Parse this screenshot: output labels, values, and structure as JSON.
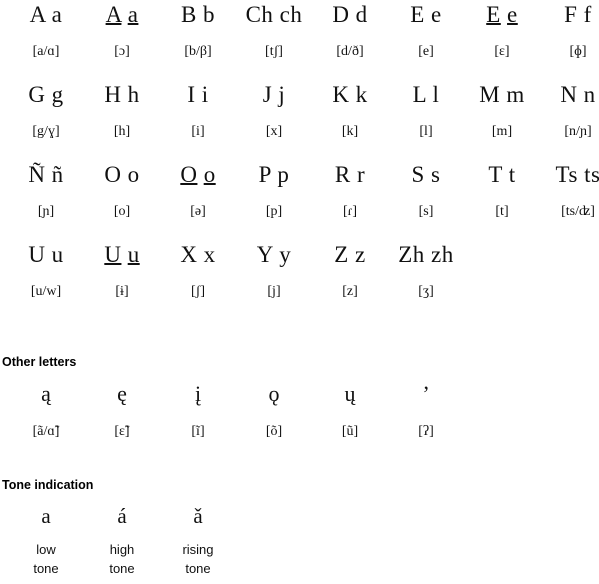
{
  "page": {
    "title": "Alphabet chart",
    "background": "#ffffff",
    "text_color": "#111111"
  },
  "alphabet": {
    "columns": 8,
    "rows": [
      [
        {
          "letter_upper": "A",
          "letter_lower": "a",
          "display": "A a",
          "underlined": false,
          "ipa": "[a/ɑ]"
        },
        {
          "letter_upper": "A̱",
          "letter_lower": "a̱",
          "display": "A a",
          "underlined": true,
          "ipa": "[ɔ]"
        },
        {
          "letter_upper": "B",
          "letter_lower": "b",
          "display": "B b",
          "underlined": false,
          "ipa": "[b/β]"
        },
        {
          "letter_upper": "Ch",
          "letter_lower": "ch",
          "display": "Ch ch",
          "underlined": false,
          "ipa": "[tʃ]"
        },
        {
          "letter_upper": "D",
          "letter_lower": "d",
          "display": "D d",
          "underlined": false,
          "ipa": "[d/ð]"
        },
        {
          "letter_upper": "E",
          "letter_lower": "e",
          "display": "E e",
          "underlined": false,
          "ipa": "[e]"
        },
        {
          "letter_upper": "E̱",
          "letter_lower": "e̱",
          "display": "E e",
          "underlined": true,
          "ipa": "[ɛ]"
        },
        {
          "letter_upper": "F",
          "letter_lower": "f",
          "display": "F f",
          "underlined": false,
          "ipa": "[ɸ]"
        }
      ],
      [
        {
          "letter_upper": "G",
          "letter_lower": "g",
          "display": "G g",
          "underlined": false,
          "ipa": "[g/ɣ]"
        },
        {
          "letter_upper": "H",
          "letter_lower": "h",
          "display": "H h",
          "underlined": false,
          "ipa": "[h]"
        },
        {
          "letter_upper": "I",
          "letter_lower": "i",
          "display": "I i",
          "underlined": false,
          "ipa": "[i]"
        },
        {
          "letter_upper": "J",
          "letter_lower": "j",
          "display": "J j",
          "underlined": false,
          "ipa": "[x]"
        },
        {
          "letter_upper": "K",
          "letter_lower": "k",
          "display": "K k",
          "underlined": false,
          "ipa": "[k]"
        },
        {
          "letter_upper": "L",
          "letter_lower": "l",
          "display": "L l",
          "underlined": false,
          "ipa": "[l]"
        },
        {
          "letter_upper": "M",
          "letter_lower": "m",
          "display": "M m",
          "underlined": false,
          "ipa": "[m]"
        },
        {
          "letter_upper": "N",
          "letter_lower": "n",
          "display": "N n",
          "underlined": false,
          "ipa": "[n/ɲ]"
        }
      ],
      [
        {
          "letter_upper": "Ñ",
          "letter_lower": "ñ",
          "display": "Ñ ñ",
          "underlined": false,
          "ipa": "[ɲ]"
        },
        {
          "letter_upper": "O",
          "letter_lower": "o",
          "display": "O o",
          "underlined": false,
          "ipa": "[o]"
        },
        {
          "letter_upper": "O̱",
          "letter_lower": "o̱",
          "display": "O o",
          "underlined": true,
          "ipa": "[ə]"
        },
        {
          "letter_upper": "P",
          "letter_lower": "p",
          "display": "P p",
          "underlined": false,
          "ipa": "[p]"
        },
        {
          "letter_upper": "R",
          "letter_lower": "r",
          "display": "R r",
          "underlined": false,
          "ipa": "[ɾ]"
        },
        {
          "letter_upper": "S",
          "letter_lower": "s",
          "display": "S s",
          "underlined": false,
          "ipa": "[s]"
        },
        {
          "letter_upper": "T",
          "letter_lower": "t",
          "display": "T t",
          "underlined": false,
          "ipa": "[t]"
        },
        {
          "letter_upper": "Ts",
          "letter_lower": "ts",
          "display": "Ts ts",
          "underlined": false,
          "ipa": "[ts/ʣ]"
        }
      ],
      [
        {
          "letter_upper": "U",
          "letter_lower": "u",
          "display": "U u",
          "underlined": false,
          "ipa": "[u/w]"
        },
        {
          "letter_upper": "U̱",
          "letter_lower": "u̱",
          "display": "U u",
          "underlined": true,
          "ipa": "[ɨ]"
        },
        {
          "letter_upper": "X",
          "letter_lower": "x",
          "display": "X x",
          "underlined": false,
          "ipa": "[ʃ]"
        },
        {
          "letter_upper": "Y",
          "letter_lower": "y",
          "display": "Y y",
          "underlined": false,
          "ipa": "[j]"
        },
        {
          "letter_upper": "Z",
          "letter_lower": "z",
          "display": "Z z",
          "underlined": false,
          "ipa": "[z]"
        },
        {
          "letter_upper": "Zh",
          "letter_lower": "zh",
          "display": "Zh zh",
          "underlined": false,
          "ipa": "[ʒ]"
        }
      ]
    ]
  },
  "other_letters": {
    "heading": "Other letters",
    "items": [
      {
        "letter": "ą",
        "ipa": "[ã/ɑ̃]"
      },
      {
        "letter": "ę",
        "ipa": "[ɛ̃]"
      },
      {
        "letter": "į",
        "ipa": "[ĩ]"
      },
      {
        "letter": "ǫ",
        "ipa": "[õ]"
      },
      {
        "letter": "ų",
        "ipa": "[ũ]"
      },
      {
        "letter": "’",
        "ipa": "[ʔ]"
      }
    ]
  },
  "tone_indication": {
    "heading": "Tone indication",
    "items": [
      {
        "letter": "a",
        "label_line1": "low",
        "label_line2": "tone"
      },
      {
        "letter": "á",
        "label_line1": "high",
        "label_line2": "tone"
      },
      {
        "letter": "ǎ",
        "label_line1": "rising",
        "label_line2": "tone"
      }
    ]
  }
}
